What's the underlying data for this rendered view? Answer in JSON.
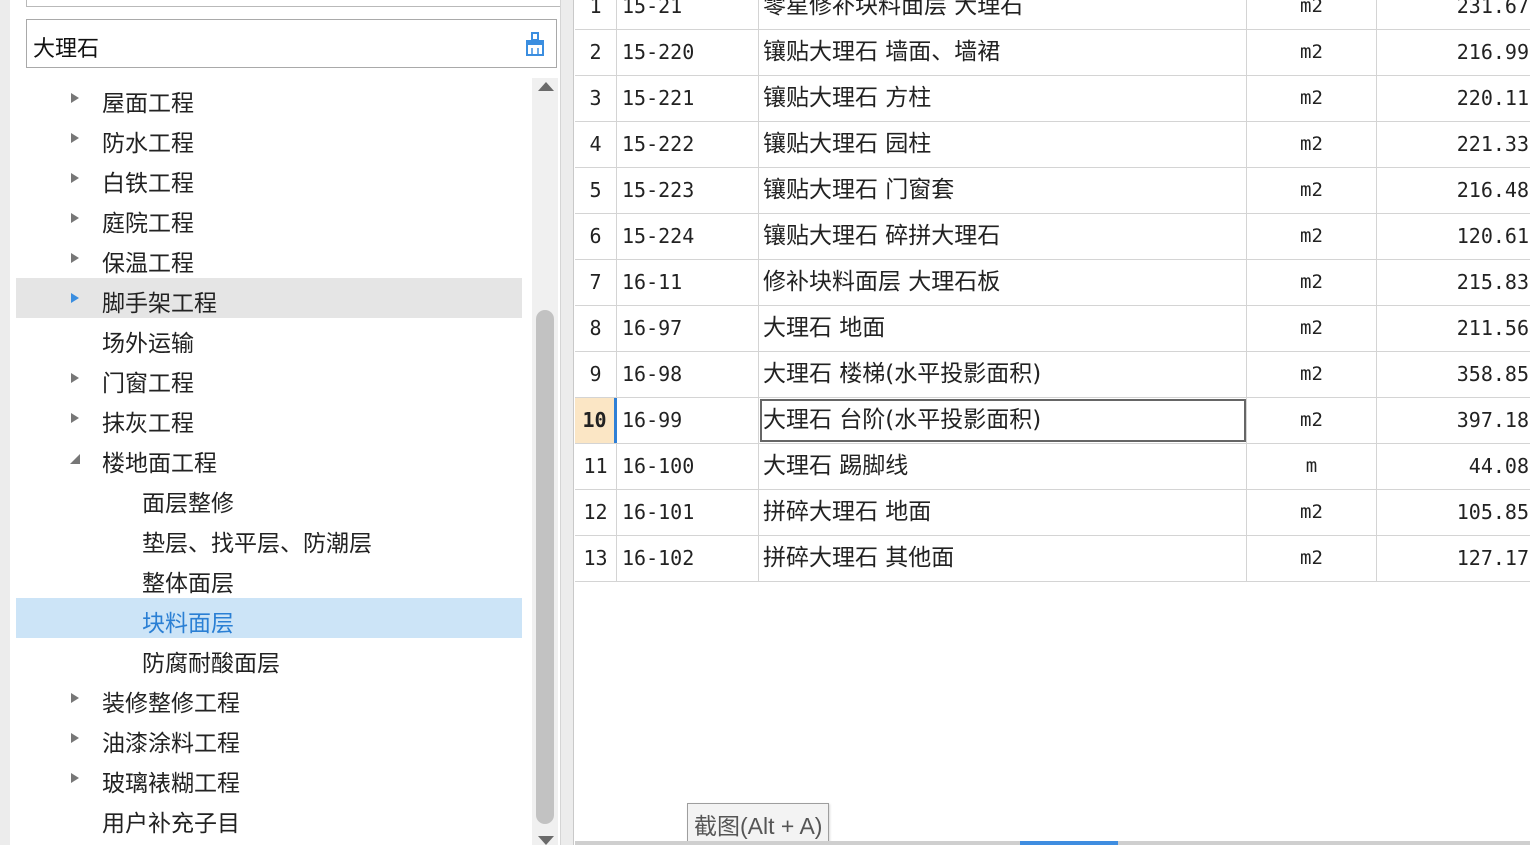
{
  "search": {
    "value": "大理石",
    "icon": "clear-brush-icon"
  },
  "tree": {
    "items": [
      {
        "label": "屋面工程",
        "arrow": "collapsed",
        "level": 1,
        "state": ""
      },
      {
        "label": "防水工程",
        "arrow": "collapsed",
        "level": 1,
        "state": ""
      },
      {
        "label": "白铁工程",
        "arrow": "collapsed",
        "level": 1,
        "state": ""
      },
      {
        "label": "庭院工程",
        "arrow": "collapsed",
        "level": 1,
        "state": ""
      },
      {
        "label": "保温工程",
        "arrow": "collapsed",
        "level": 1,
        "state": ""
      },
      {
        "label": "脚手架工程",
        "arrow": "collapsed-blue",
        "level": 1,
        "state": "hover"
      },
      {
        "label": "场外运输",
        "arrow": "none",
        "level": 1,
        "state": ""
      },
      {
        "label": "门窗工程",
        "arrow": "collapsed",
        "level": 1,
        "state": ""
      },
      {
        "label": "抹灰工程",
        "arrow": "collapsed",
        "level": 1,
        "state": ""
      },
      {
        "label": "楼地面工程",
        "arrow": "expanded",
        "level": 1,
        "state": ""
      },
      {
        "label": "面层整修",
        "arrow": "none",
        "level": 2,
        "state": ""
      },
      {
        "label": "垫层、找平层、防潮层",
        "arrow": "none",
        "level": 2,
        "state": ""
      },
      {
        "label": "整体面层",
        "arrow": "none",
        "level": 2,
        "state": ""
      },
      {
        "label": "块料面层",
        "arrow": "none",
        "level": 2,
        "state": "selected"
      },
      {
        "label": "防腐耐酸面层",
        "arrow": "none",
        "level": 2,
        "state": ""
      },
      {
        "label": "装修整修工程",
        "arrow": "collapsed",
        "level": 1,
        "state": ""
      },
      {
        "label": "油漆涂料工程",
        "arrow": "collapsed",
        "level": 1,
        "state": ""
      },
      {
        "label": "玻璃裱糊工程",
        "arrow": "collapsed",
        "level": 1,
        "state": ""
      },
      {
        "label": "用户补充子目",
        "arrow": "none",
        "level": 1,
        "state": ""
      }
    ]
  },
  "grid": {
    "rows": [
      {
        "num": "1",
        "code": "15-21",
        "name": "零星修补块料面层 大理石",
        "unit": "m2",
        "price": "231.67"
      },
      {
        "num": "2",
        "code": "15-220",
        "name": "镶贴大理石 墙面、墙裙",
        "unit": "m2",
        "price": "216.99"
      },
      {
        "num": "3",
        "code": "15-221",
        "name": "镶贴大理石 方柱",
        "unit": "m2",
        "price": "220.11"
      },
      {
        "num": "4",
        "code": "15-222",
        "name": "镶贴大理石 园柱",
        "unit": "m2",
        "price": "221.33"
      },
      {
        "num": "5",
        "code": "15-223",
        "name": "镶贴大理石 门窗套",
        "unit": "m2",
        "price": "216.48"
      },
      {
        "num": "6",
        "code": "15-224",
        "name": "镶贴大理石 碎拼大理石",
        "unit": "m2",
        "price": "120.61"
      },
      {
        "num": "7",
        "code": "16-11",
        "name": "修补块料面层 大理石板",
        "unit": "m2",
        "price": "215.83"
      },
      {
        "num": "8",
        "code": "16-97",
        "name": "大理石 地面",
        "unit": "m2",
        "price": "211.56"
      },
      {
        "num": "9",
        "code": "16-98",
        "name": "大理石 楼梯(水平投影面积)",
        "unit": "m2",
        "price": "358.85"
      },
      {
        "num": "10",
        "code": "16-99",
        "name": "大理石 台阶(水平投影面积)",
        "unit": "m2",
        "price": "397.18",
        "current": true
      },
      {
        "num": "11",
        "code": "16-100",
        "name": "大理石 踢脚线",
        "unit": "m",
        "price": "44.08"
      },
      {
        "num": "12",
        "code": "16-101",
        "name": "拼碎大理石 地面",
        "unit": "m2",
        "price": "105.85"
      },
      {
        "num": "13",
        "code": "16-102",
        "name": "拼碎大理石 其他面",
        "unit": "m2",
        "price": "127.17"
      }
    ]
  },
  "tooltip": {
    "text": "截图(Alt + A)"
  },
  "colors": {
    "selected_bg": "#cce4f7",
    "selected_text": "#2a7fd4",
    "current_row_num_bg": "#fbe6c5",
    "accent": "#2f7fd6"
  }
}
